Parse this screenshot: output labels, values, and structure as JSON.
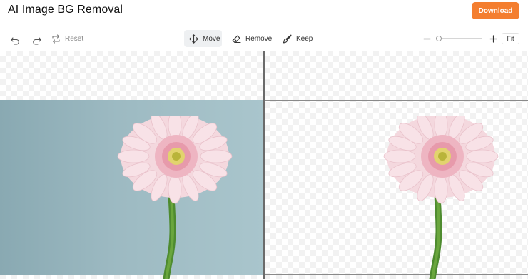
{
  "header": {
    "title": "AI Image BG Removal",
    "download_label": "Download",
    "accent_color": "#f47e2f"
  },
  "toolbar": {
    "undo_icon": "undo-icon",
    "redo_icon": "redo-icon",
    "reset_label": "Reset",
    "move_label": "Move",
    "remove_label": "Remove",
    "keep_label": "Keep",
    "active_tool": "Move",
    "fit_label": "Fit",
    "zoom_level": 0
  },
  "canvas": {
    "left_pane": "original",
    "right_pane": "background-removed",
    "subject": "pink gerbera flower"
  }
}
